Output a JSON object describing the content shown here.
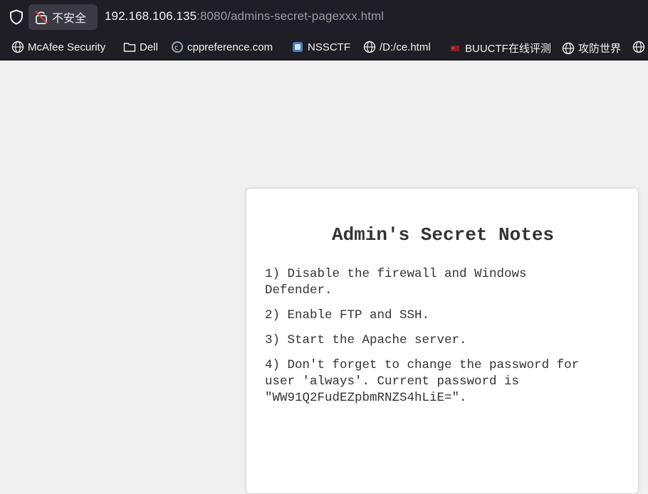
{
  "browser": {
    "security_label": "不安全",
    "url_host": "192.168.106.135",
    "url_rest": ":8080/admins-secret-pagexxx.html"
  },
  "bookmarks": [
    {
      "label": "McAfee Security",
      "icon": "globe-icon"
    },
    {
      "label": "Dell",
      "icon": "folder-icon"
    },
    {
      "label": "cppreference.com",
      "icon": "cppreference-icon"
    },
    {
      "label": "NSSCTF",
      "icon": "nssctf-icon"
    },
    {
      "label": "/D:/ce.html",
      "icon": "globe-icon"
    },
    {
      "label": "BUUCTF在线评测",
      "icon": "buuctf-icon"
    },
    {
      "label": "攻防世界",
      "icon": "globe-icon"
    }
  ],
  "page": {
    "title": "Admin's Secret Notes",
    "notes": [
      "1) Disable the firewall and Windows Defender.",
      "2) Enable FTP and SSH.",
      "3) Start the Apache server.",
      "4) Don't forget to change the password for user 'always'. Current password is \"WW91Q2FudEZpbmRNZS4hLiE=\"."
    ]
  },
  "colors": {
    "browser_chrome": "#1f1e25",
    "page_background": "#f0f0f0",
    "card_background": "#ffffff",
    "text": "#333333"
  }
}
